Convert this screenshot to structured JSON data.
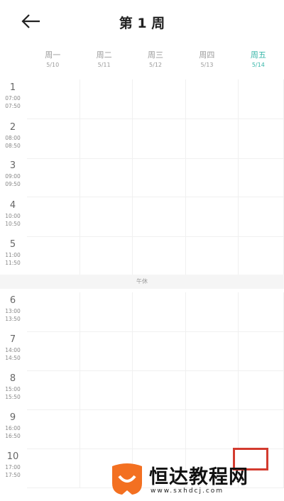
{
  "header": {
    "title": "第 1 周",
    "back_icon": "arrow-left-icon"
  },
  "days": [
    {
      "name": "周一",
      "date": "5/10"
    },
    {
      "name": "周二",
      "date": "5/11"
    },
    {
      "name": "周三",
      "date": "5/12"
    },
    {
      "name": "周四",
      "date": "5/13"
    },
    {
      "name": "周五",
      "date": "5/14",
      "today": true
    }
  ],
  "periods": [
    {
      "num": "1",
      "start": "07:00",
      "end": "07:50"
    },
    {
      "num": "2",
      "start": "08:00",
      "end": "08:50"
    },
    {
      "num": "3",
      "start": "09:00",
      "end": "09:50"
    },
    {
      "num": "4",
      "start": "10:00",
      "end": "10:50"
    },
    {
      "num": "5",
      "start": "11:00",
      "end": "11:50"
    },
    {
      "num": "6",
      "start": "13:00",
      "end": "13:50"
    },
    {
      "num": "7",
      "start": "14:00",
      "end": "14:50"
    },
    {
      "num": "8",
      "start": "15:00",
      "end": "15:50"
    },
    {
      "num": "9",
      "start": "16:00",
      "end": "16:50"
    },
    {
      "num": "10",
      "start": "17:00",
      "end": "17:50"
    }
  ],
  "noon_label": "午休",
  "colors": {
    "accent": "#36b6a8",
    "watermark_orange": "#f37021",
    "button_red": "#d33b2f"
  },
  "watermark": {
    "text": "恒达教程网",
    "url": "www.sxhdcj.com"
  }
}
